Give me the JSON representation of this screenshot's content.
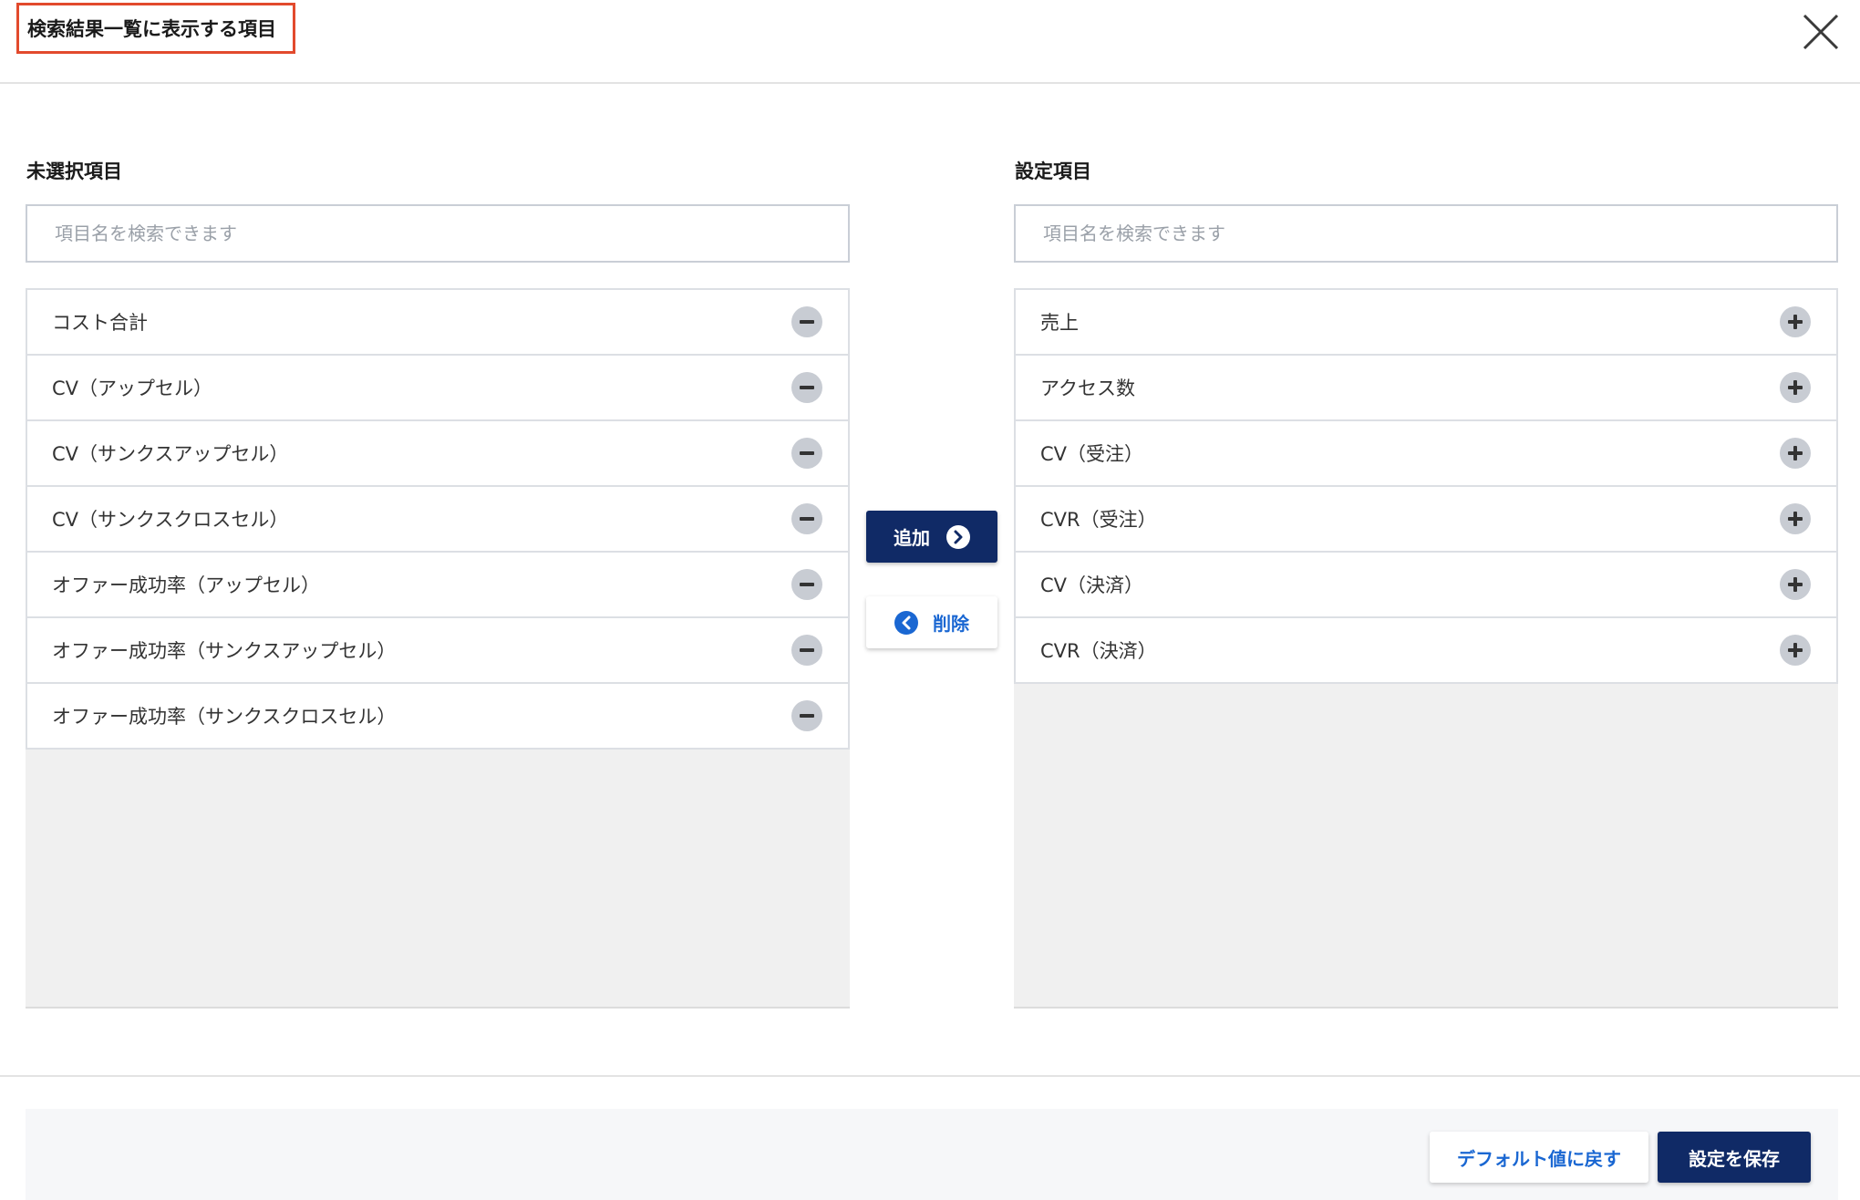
{
  "dialog": {
    "title": "検索結果一覧に表示する項目"
  },
  "unselected": {
    "label": "未選択項目",
    "search_placeholder": "項目名を検索できます",
    "items": [
      "コスト合計",
      "CV（アップセル）",
      "CV（サンクスアップセル）",
      "CV（サンクスクロスセル）",
      "オファー成功率（アップセル）",
      "オファー成功率（サンクスアップセル）",
      "オファー成功率（サンクスクロスセル）"
    ]
  },
  "selected": {
    "label": "設定項目",
    "search_placeholder": "項目名を検索できます",
    "items": [
      "売上",
      "アクセス数",
      "CV（受注）",
      "CVR（受注）",
      "CV（決済）",
      "CVR（決済）"
    ]
  },
  "transfer": {
    "add_label": "追加",
    "remove_label": "削除"
  },
  "footer": {
    "reset_label": "デフォルト値に戻す",
    "save_label": "設定を保存"
  },
  "colors": {
    "primary": "#102a66",
    "link": "#1a67d2",
    "highlight_border": "#e24a2d"
  }
}
